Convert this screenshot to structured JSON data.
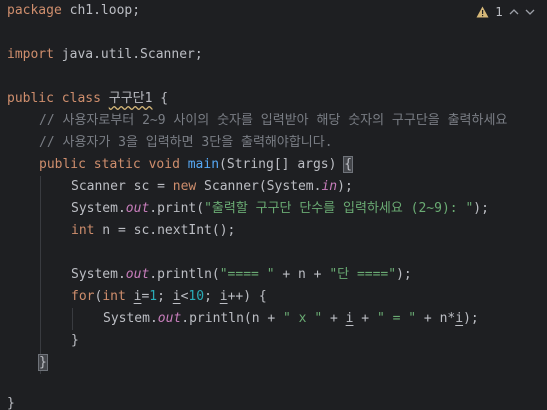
{
  "inspection": {
    "warning_count": "1",
    "warning_color": "#d5b778"
  },
  "colors": {
    "background": "#1e1f22",
    "keyword": "#cf8e6d",
    "string": "#6aab73",
    "number": "#2aacb8",
    "comment": "#7a7e85",
    "method": "#56a8f5",
    "field": "#c77dbb",
    "text": "#bcbec4"
  },
  "code": {
    "l1": {
      "kw": "package",
      "rest": " ch1.loop;"
    },
    "l3": {
      "kw": "import",
      "rest": " java.util.Scanner;"
    },
    "l5": {
      "kw1": "public",
      "kw2": "class",
      "name": "구구단1",
      "rest": " {"
    },
    "l6": {
      "comment": "// 사용자로부터 2~9 사이의 숫자를 입력받아 해당 숫자의 구구단을 출력하세요"
    },
    "l7": {
      "comment": "// 사용자가 3을 입력하면 3단을 출력해야합니다."
    },
    "l8": {
      "kw1": "public",
      "kw2": "static",
      "kw3": "void",
      "method": "main",
      "params": "(String[] args) ",
      "brace": "{"
    },
    "l9": {
      "a": "Scanner sc = ",
      "kw": "new",
      "b": " Scanner(System.",
      "field": "in",
      "c": ");"
    },
    "l10": {
      "a": "System.",
      "field": "out",
      "b": ".print(",
      "str": "\"출력할 구구단 단수를 입력하세요 (2~9): \"",
      "c": ");"
    },
    "l11": {
      "kw": "int",
      "rest": " n = sc.nextInt();"
    },
    "l13": {
      "a": "System.",
      "field": "out",
      "b": ".println(",
      "s1": "\"==== \"",
      "c": " + n + ",
      "s2": "\"단 ====\"",
      "d": ");"
    },
    "l14": {
      "kw1": "for",
      "a": "(",
      "kw2": "int",
      "sp": " ",
      "i1": "i",
      "eq": "=",
      "n1": "1",
      "semi1": "; ",
      "i2": "i",
      "lt": "<",
      "n2": "10",
      "semi2": "; ",
      "i3": "i",
      "inc": "++) {"
    },
    "l15": {
      "a": "System.",
      "field": "out",
      "b": ".println(n + ",
      "s1": "\" x \"",
      "c": " + ",
      "i": "i",
      "d": " + ",
      "s2": "\" = \"",
      "e": " + n*",
      "i2": "i",
      "f": ");"
    },
    "l16": {
      "text": "}"
    },
    "l17": {
      "text": "}"
    },
    "l19": {
      "text": "}"
    }
  }
}
